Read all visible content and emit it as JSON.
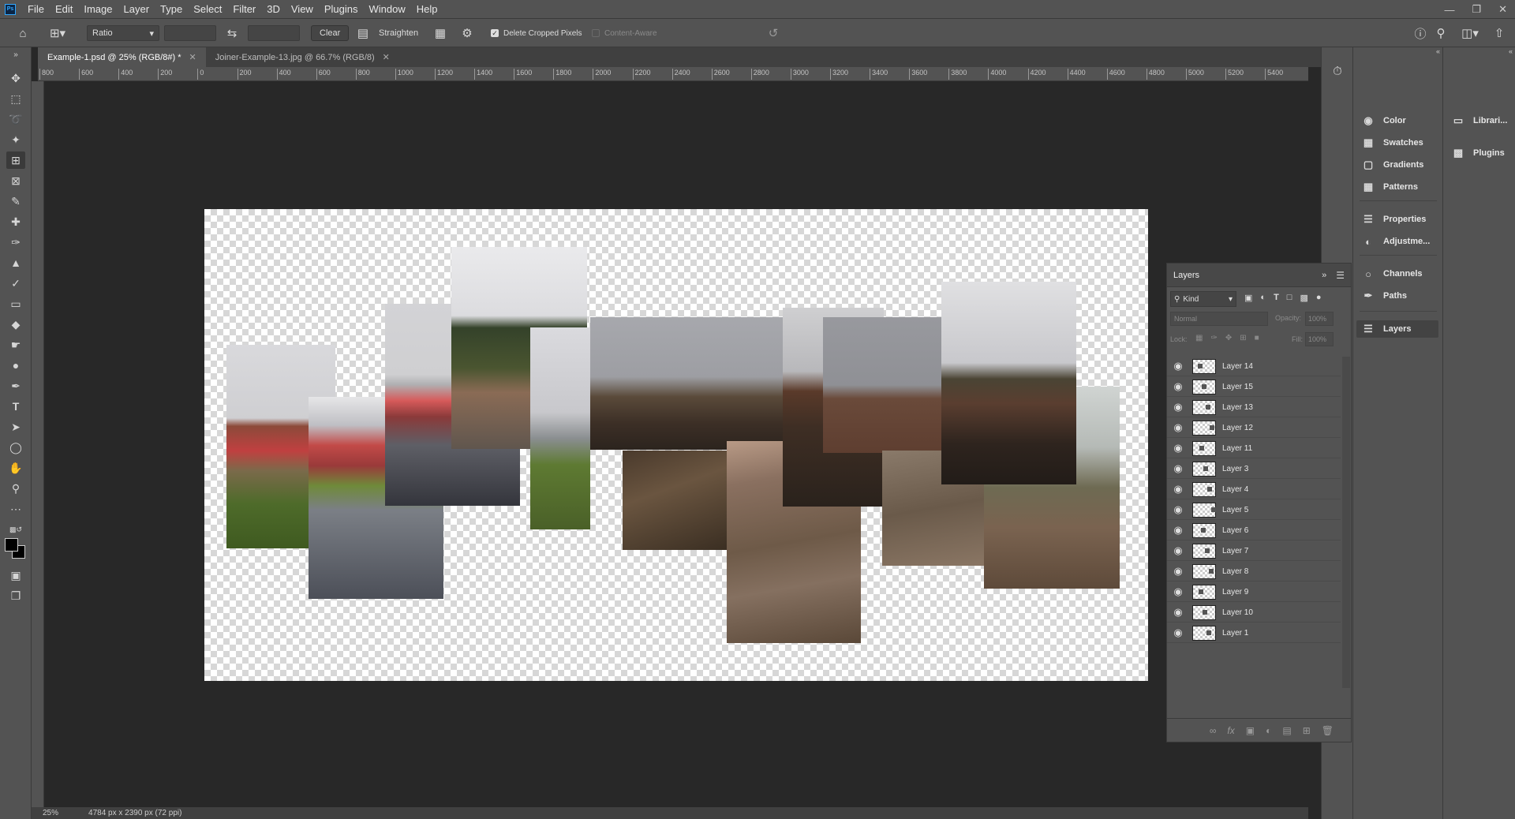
{
  "menu": [
    "File",
    "Edit",
    "Image",
    "Layer",
    "Type",
    "Select",
    "Filter",
    "3D",
    "View",
    "Plugins",
    "Window",
    "Help"
  ],
  "logo_text": "Ps",
  "options": {
    "ratio_value": "Ratio",
    "clear_label": "Clear",
    "straighten_label": "Straighten",
    "delete_cropped_label": "Delete Cropped Pixels",
    "content_aware_label": "Content-Aware"
  },
  "tabs": [
    {
      "label": "Example-1.psd @ 25% (RGB/8#) *",
      "active": true
    },
    {
      "label": "Joiner-Example-13.jpg @ 66.7% (RGB/8)",
      "active": false
    }
  ],
  "ruler_labels": [
    "800",
    "600",
    "400",
    "200",
    "0",
    "200",
    "400",
    "600",
    "800",
    "1000",
    "1200",
    "1400",
    "1600",
    "1800",
    "2000",
    "2200",
    "2400",
    "2600",
    "2800",
    "3000",
    "3200",
    "3400",
    "3600",
    "3800",
    "4000",
    "4200",
    "4400",
    "4600",
    "4800",
    "5000",
    "5200",
    "5400"
  ],
  "status": {
    "zoom": "25%",
    "doc_info": "4784 px x 2390 px (72 ppi)"
  },
  "right_panels": [
    "Color",
    "Swatches",
    "Gradients",
    "Patterns",
    "Properties",
    "Adjustme...",
    "Channels",
    "Paths",
    "Layers"
  ],
  "far_right_panels": [
    "Librari...",
    "Plugins"
  ],
  "layers_panel": {
    "title": "Layers",
    "filter_kind": "Kind",
    "blend_mode": "Normal",
    "opacity_label": "Opacity:",
    "opacity_value": "100%",
    "lock_label": "Lock:",
    "fill_label": "Fill:",
    "fill_value": "100%",
    "layers": [
      "Layer 14",
      "Layer 15",
      "Layer 13",
      "Layer 12",
      "Layer 11",
      "Layer 3",
      "Layer 4",
      "Layer 5",
      "Layer 6",
      "Layer 7",
      "Layer 8",
      "Layer 9",
      "Layer 10",
      "Layer 1"
    ]
  },
  "icons": {
    "home": "home-icon",
    "crop": "crop-icon",
    "swap": "swap-icon",
    "grid": "grid-overlay-icon",
    "gear": "gear-icon",
    "reset": "reset-icon"
  }
}
